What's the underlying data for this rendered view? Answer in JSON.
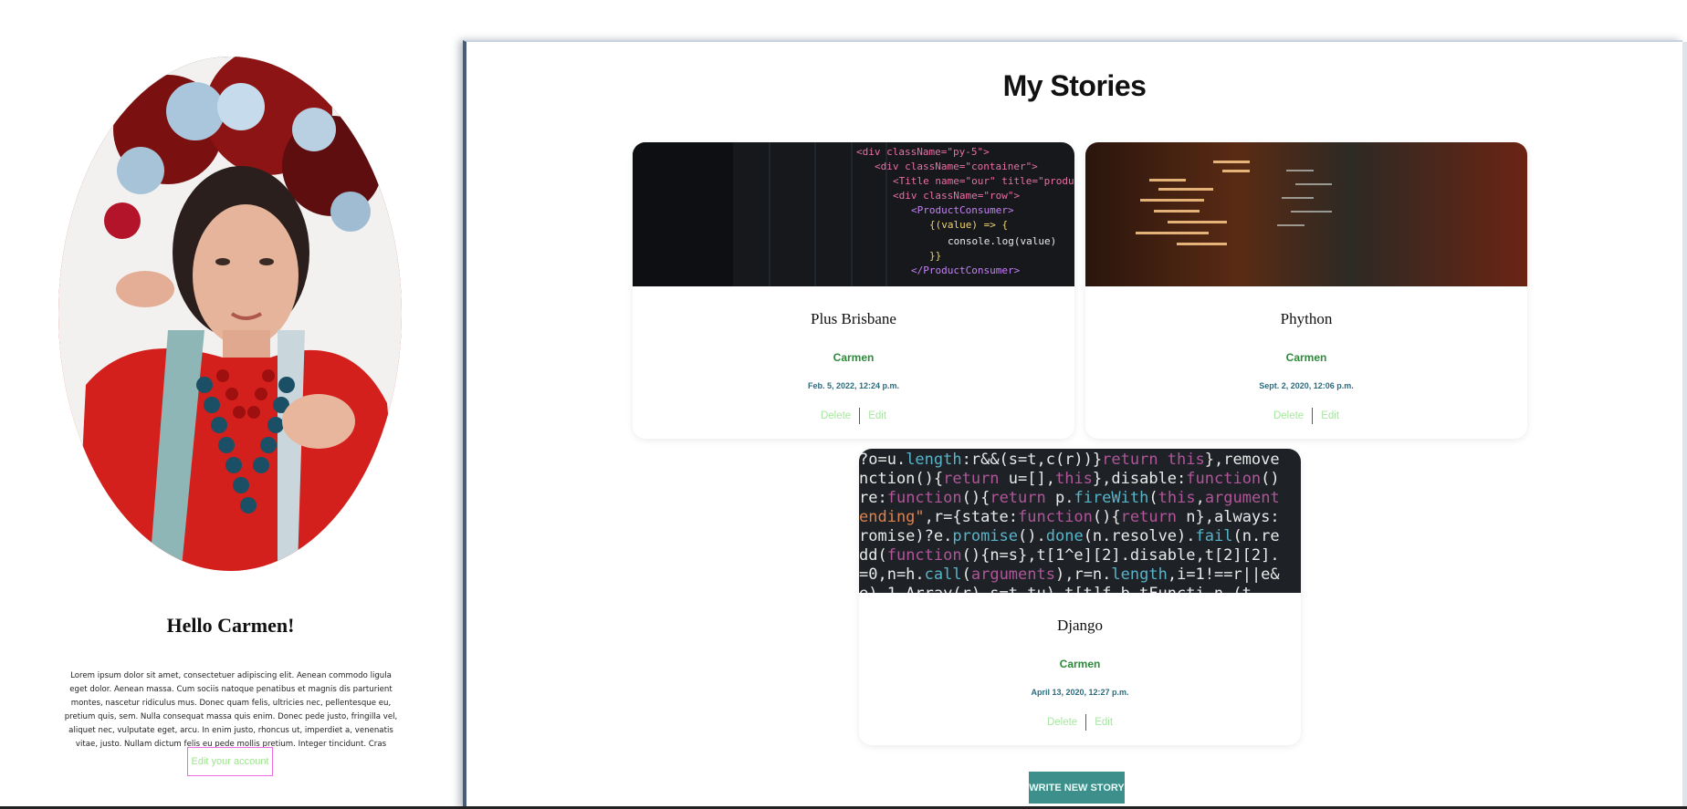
{
  "profile": {
    "greeting": "Hello Carmen!",
    "bio": "Lorem ipsum dolor sit amet, consectetuer adipiscing elit. Aenean commodo ligula eget dolor. Aenean massa. Cum sociis natoque penatibus et magnis dis parturient montes, nascetur ridiculus mus. Donec quam felis, ultricies nec, pellentesque eu, pretium quis, sem. Nulla consequat massa quis enim. Donec pede justo, fringilla vel, aliquet nec, vulputate eget, arcu. In enim justo, rhoncus ut, imperdiet a, venenatis vitae, justo. Nullam dictum felis eu pede mollis pretium. Integer tincidunt. Cras dapibu",
    "edit_account_label": "Edit your account"
  },
  "stories": {
    "title": "My Stories",
    "items": [
      {
        "title": "Plus Brisbane",
        "author": "Carmen",
        "date": "Feb. 5, 2022, 12:24 p.m.",
        "delete_label": "Delete",
        "edit_label": "Edit"
      },
      {
        "title": "Phython",
        "author": "Carmen",
        "date": "Sept. 2, 2020, 12:06 p.m.",
        "delete_label": "Delete",
        "edit_label": "Edit"
      },
      {
        "title": "Django",
        "author": "Carmen",
        "date": "April 13, 2020, 12:27 p.m.",
        "delete_label": "Delete",
        "edit_label": "Edit"
      }
    ],
    "write_new_label": "WRITE NEW STORY"
  },
  "colors": {
    "author": "#2c8a3a",
    "date": "#2b6b7e",
    "action_link": "#a6e6a0",
    "write_button": "#3d8f8c",
    "edit_account_border": "#ee6ce3"
  }
}
